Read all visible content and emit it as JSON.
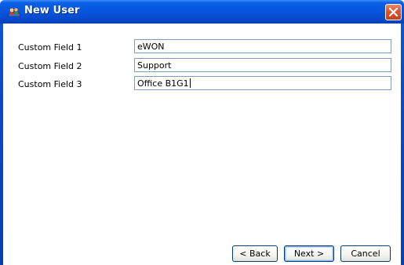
{
  "window": {
    "title": "New User",
    "app_icon": "user-group-icon",
    "close_icon": "close-icon"
  },
  "fields": [
    {
      "label": "Custom Field 1",
      "value": "eWON"
    },
    {
      "label": "Custom Field 2",
      "value": "Support"
    },
    {
      "label": "Custom Field 3",
      "value": "Office B1G1"
    }
  ],
  "buttons": {
    "back": "< Back",
    "next": "Next >",
    "cancel": "Cancel"
  },
  "colors": {
    "titlebar": "#0655dd",
    "close": "#d9552f",
    "field_border": "#7f9db9",
    "button_border": "#003c74"
  }
}
